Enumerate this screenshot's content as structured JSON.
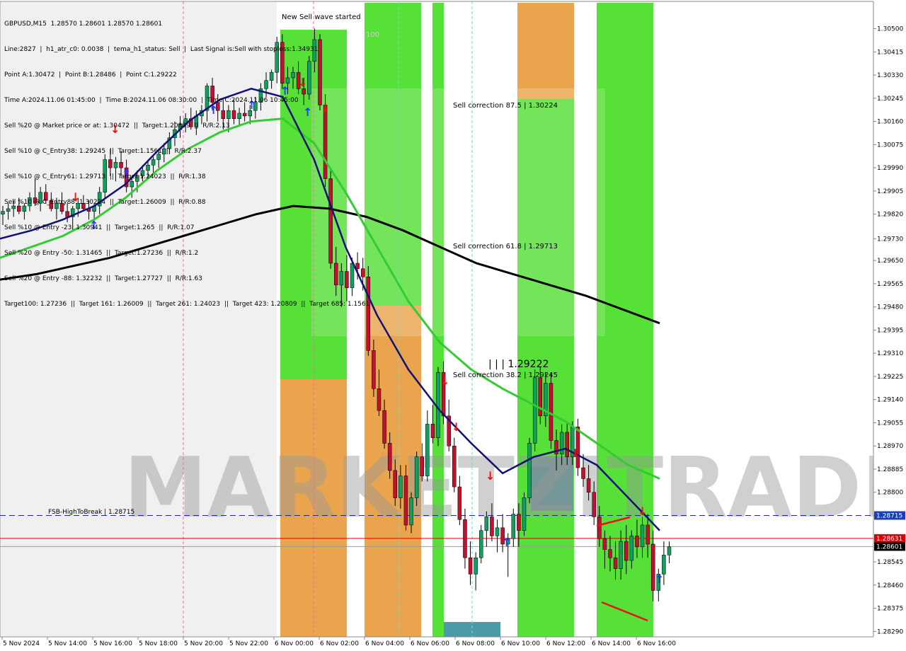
{
  "header": {
    "symbol_line": "GBPUSD,M15  1.28570 1.28601 1.28570 1.28601",
    "lines": [
      "Line:2827  |  h1_atr_c0: 0.0038  |  tema_h1_status: Sell  |  Last Signal is:Sell with stoploss:1.34931",
      "Point A:1.30472  |  Point B:1.28486  |  Point C:1.29222",
      "Time A:2024.11.06 01:45:00  |  Time B:2024.11.06 08:30:00  |  Time C:2024.11.06 10:45:00",
      "Sell %20 @ Market price or at: 1.30472  ||  Target:1.20809  ||  R/R:2.13",
      "Sell %10 @ C_Entry38: 1.29245  ||  Target:1.1561  ||  R/R:2.37",
      "Sell %10 @ C_Entry61: 1.29713  ||  Target:1.24023  ||  R/R:1.38",
      "Sell %10 @ C_Entry88: 1.30224  ||  Target:1.26009  ||  R/R:0.88",
      "Sell %10 @ Entry -23: 1.30941  ||  Target:1.265  ||  R/R:1.07",
      "Sell %20 @ Entry -50: 1.31465  ||  Target:1.27236  ||  R/R:1.2",
      "Sell %20 @ Entry -88: 1.32232  ||  Target:1.27727  ||  R/R:1.63",
      "Target100: 1.27236  ||  Target 161: 1.26009  ||  Target 261: 1.24023  ||  Target 423: 1.20809  ||  Target 685: 1.1561"
    ]
  },
  "annotations": {
    "new_wave": "New Sell wave started",
    "hundred": "100",
    "sell_corr_875": "Sell correction 87.5 | 1.30224",
    "sell_corr_618": "Sell correction 61.8 | 1.29713",
    "sell_corr_382": "Sell correction 38.2 | 1.29245",
    "point_c": "| | |  1.29222",
    "fsb": "FSB-HighToBreak  |  1.28715",
    "watermark": "MARKETZITRADE"
  },
  "price_tags": {
    "fsb": "1.28715",
    "current": "1.28601",
    "red_line": "1.28631"
  },
  "colors": {
    "bull": "#0ea060",
    "bear": "#c41030",
    "green_zone": "#44dd22",
    "orange_zone": "#e89a3a",
    "ma_fast": "#101078",
    "ma_mid": "#33cc33",
    "ma_slow": "#000000",
    "signal_up": "#1a3fff",
    "signal_down": "#ee1111"
  },
  "chart_data": {
    "type": "candlestick",
    "symbol": "GBPUSD",
    "timeframe": "M15",
    "ylim": [
      1.2827,
      1.306
    ],
    "y_ticks": [
      "1.30500",
      "1.30415",
      "1.30330",
      "1.30245",
      "1.30160",
      "1.30075",
      "1.29990",
      "1.29905",
      "1.29820",
      "1.29730",
      "1.29650",
      "1.29565",
      "1.29480",
      "1.29395",
      "1.29310",
      "1.29225",
      "1.29140",
      "1.29055",
      "1.28970",
      "1.28885",
      "1.28800",
      "1.28715",
      "1.28630",
      "1.28545",
      "1.28460",
      "1.28375",
      "1.28290"
    ],
    "x_ticks": [
      "5 Nov 2024",
      "5 Nov 14:00",
      "5 Nov 16:00",
      "5 Nov 18:00",
      "5 Nov 20:00",
      "5 Nov 22:00",
      "6 Nov 00:00",
      "6 Nov 02:00",
      "6 Nov 04:00",
      "6 Nov 06:00",
      "6 Nov 08:00",
      "6 Nov 10:00",
      "6 Nov 12:00",
      "6 Nov 14:00",
      "6 Nov 16:00"
    ],
    "candles": [
      [
        1.2982,
        1.2985,
        1.2978,
        1.2983
      ],
      [
        1.2983,
        1.2986,
        1.298,
        1.2984
      ],
      [
        1.2984,
        1.2987,
        1.2981,
        1.2985
      ],
      [
        1.2985,
        1.2988,
        1.2982,
        1.2983
      ],
      [
        1.2983,
        1.2986,
        1.298,
        1.2985
      ],
      [
        1.2985,
        1.299,
        1.2983,
        1.2988
      ],
      [
        1.2988,
        1.2995,
        1.2985,
        1.2986
      ],
      [
        1.2986,
        1.2992,
        1.2983,
        1.299
      ],
      [
        1.299,
        1.2993,
        1.2986,
        1.2987
      ],
      [
        1.2987,
        1.299,
        1.2983,
        1.2984
      ],
      [
        1.2984,
        1.2988,
        1.298,
        1.2986
      ],
      [
        1.2986,
        1.299,
        1.2982,
        1.2983
      ],
      [
        1.2983,
        1.2986,
        1.2979,
        1.2981
      ],
      [
        1.2981,
        1.2985,
        1.2976,
        1.2984
      ],
      [
        1.2984,
        1.2988,
        1.2981,
        1.2986
      ],
      [
        1.2986,
        1.2989,
        1.2983,
        1.2984
      ],
      [
        1.2984,
        1.2987,
        1.298,
        1.2983
      ],
      [
        1.2983,
        1.2986,
        1.2979,
        1.2985
      ],
      [
        1.2985,
        1.2992,
        1.2982,
        1.299
      ],
      [
        1.299,
        1.3004,
        1.2988,
        1.3002
      ],
      [
        1.3002,
        1.3006,
        1.2996,
        1.2999
      ],
      [
        1.2999,
        1.3003,
        1.2994,
        1.3001
      ],
      [
        1.3001,
        1.3005,
        1.2996,
        1.2999
      ],
      [
        1.2999,
        1.3002,
        1.299,
        1.2992
      ],
      [
        1.2992,
        1.2996,
        1.2988,
        1.2994
      ],
      [
        1.2994,
        1.2998,
        1.299,
        1.2996
      ],
      [
        1.2996,
        1.3,
        1.2994,
        1.2998
      ],
      [
        1.2998,
        1.3002,
        1.2995,
        1.3
      ],
      [
        1.3,
        1.3003,
        1.2997,
        1.3002
      ],
      [
        1.3002,
        1.3006,
        1.2999,
        1.3004
      ],
      [
        1.3004,
        1.3008,
        1.3001,
        1.3006
      ],
      [
        1.3006,
        1.3012,
        1.3004,
        1.301
      ],
      [
        1.301,
        1.3016,
        1.3007,
        1.3013
      ],
      [
        1.3013,
        1.3018,
        1.301,
        1.3015
      ],
      [
        1.3015,
        1.3019,
        1.3012,
        1.3017
      ],
      [
        1.3017,
        1.3021,
        1.3013,
        1.3014
      ],
      [
        1.3014,
        1.302,
        1.3011,
        1.3018
      ],
      [
        1.3018,
        1.3022,
        1.3015,
        1.302
      ],
      [
        1.302,
        1.303,
        1.3016,
        1.3029
      ],
      [
        1.3029,
        1.3032,
        1.302,
        1.3023
      ],
      [
        1.3023,
        1.3026,
        1.3016,
        1.302
      ],
      [
        1.302,
        1.3024,
        1.3013,
        1.3017
      ],
      [
        1.3017,
        1.3022,
        1.3012,
        1.302
      ],
      [
        1.302,
        1.3024,
        1.3015,
        1.3017
      ],
      [
        1.3017,
        1.3021,
        1.3014,
        1.3019
      ],
      [
        1.3019,
        1.3023,
        1.3016,
        1.3018
      ],
      [
        1.3018,
        1.3022,
        1.3015,
        1.302
      ],
      [
        1.302,
        1.3025,
        1.3017,
        1.3023
      ],
      [
        1.3023,
        1.303,
        1.302,
        1.3028
      ],
      [
        1.3028,
        1.3034,
        1.3025,
        1.3031
      ],
      [
        1.3031,
        1.3035,
        1.3028,
        1.3034
      ],
      [
        1.3034,
        1.3047,
        1.303,
        1.3045
      ],
      [
        1.3045,
        1.3048,
        1.3028,
        1.303
      ],
      [
        1.303,
        1.3036,
        1.3026,
        1.3032
      ],
      [
        1.3032,
        1.3036,
        1.3028,
        1.3034
      ],
      [
        1.3034,
        1.3038,
        1.3026,
        1.3028
      ],
      [
        1.3028,
        1.3032,
        1.3022,
        1.3026
      ],
      [
        1.3026,
        1.304,
        1.3024,
        1.3038
      ],
      [
        1.3038,
        1.305,
        1.3034,
        1.3046
      ],
      [
        1.3046,
        1.3048,
        1.302,
        1.3022
      ],
      [
        1.3022,
        1.3026,
        1.2992,
        1.2995
      ],
      [
        1.2995,
        1.2998,
        1.2962,
        1.2964
      ],
      [
        1.2964,
        1.297,
        1.2952,
        1.2956
      ],
      [
        1.2956,
        1.2964,
        1.2948,
        1.2961
      ],
      [
        1.2961,
        1.2967,
        1.295,
        1.2955
      ],
      [
        1.2955,
        1.2966,
        1.2952,
        1.2964
      ],
      [
        1.2964,
        1.2968,
        1.2958,
        1.2962
      ],
      [
        1.2962,
        1.2966,
        1.2954,
        1.2959
      ],
      [
        1.2959,
        1.2963,
        1.293,
        1.2932
      ],
      [
        1.2932,
        1.2936,
        1.2915,
        1.2918
      ],
      [
        1.2918,
        1.2925,
        1.2908,
        1.291
      ],
      [
        1.291,
        1.2914,
        1.2896,
        1.2898
      ],
      [
        1.2898,
        1.2902,
        1.2885,
        1.2888
      ],
      [
        1.2888,
        1.2892,
        1.2875,
        1.2878
      ],
      [
        1.2878,
        1.289,
        1.2874,
        1.2886
      ],
      [
        1.2886,
        1.289,
        1.2866,
        1.2868
      ],
      [
        1.2868,
        1.288,
        1.2865,
        1.2878
      ],
      [
        1.2878,
        1.2895,
        1.2875,
        1.2893
      ],
      [
        1.2893,
        1.2898,
        1.2884,
        1.2886
      ],
      [
        1.2886,
        1.291,
        1.2884,
        1.2905
      ],
      [
        1.2905,
        1.2912,
        1.2898,
        1.29
      ],
      [
        1.29,
        1.2926,
        1.2897,
        1.2924
      ],
      [
        1.2924,
        1.2928,
        1.2905,
        1.2908
      ],
      [
        1.2908,
        1.2914,
        1.2895,
        1.2897
      ],
      [
        1.2897,
        1.29,
        1.288,
        1.2882
      ],
      [
        1.2882,
        1.2886,
        1.2868,
        1.287
      ],
      [
        1.287,
        1.2874,
        1.2852,
        1.2856
      ],
      [
        1.2856,
        1.2862,
        1.2846,
        1.285
      ],
      [
        1.285,
        1.2858,
        1.2844,
        1.2856
      ],
      [
        1.2856,
        1.2868,
        1.2854,
        1.2866
      ],
      [
        1.2866,
        1.2873,
        1.286,
        1.2871
      ],
      [
        1.2871,
        1.2876,
        1.2862,
        1.2864
      ],
      [
        1.2864,
        1.287,
        1.2858,
        1.2867
      ],
      [
        1.2867,
        1.2872,
        1.2858,
        1.2861
      ],
      [
        1.2861,
        1.2865,
        1.2849,
        1.2863
      ],
      [
        1.2863,
        1.2874,
        1.286,
        1.2872
      ],
      [
        1.2872,
        1.2876,
        1.286,
        1.2866
      ],
      [
        1.2866,
        1.288,
        1.2864,
        1.2878
      ],
      [
        1.2878,
        1.29,
        1.2876,
        1.2898
      ],
      [
        1.2898,
        1.2925,
        1.2895,
        1.2922
      ],
      [
        1.2922,
        1.2926,
        1.2905,
        1.2908
      ],
      [
        1.2908,
        1.2924,
        1.2904,
        1.292
      ],
      [
        1.292,
        1.2924,
        1.2896,
        1.2899
      ],
      [
        1.2899,
        1.2903,
        1.2888,
        1.2894
      ],
      [
        1.2894,
        1.2905,
        1.289,
        1.2902
      ],
      [
        1.2902,
        1.2906,
        1.289,
        1.2893
      ],
      [
        1.2893,
        1.2906,
        1.289,
        1.2904
      ],
      [
        1.2904,
        1.2907,
        1.2886,
        1.2889
      ],
      [
        1.2889,
        1.2894,
        1.2882,
        1.2885
      ],
      [
        1.2885,
        1.289,
        1.2877,
        1.288
      ],
      [
        1.288,
        1.2884,
        1.2868,
        1.2871
      ],
      [
        1.2871,
        1.2875,
        1.286,
        1.2863
      ],
      [
        1.2863,
        1.2866,
        1.2852,
        1.2859
      ],
      [
        1.2859,
        1.2864,
        1.2851,
        1.2856
      ],
      [
        1.2856,
        1.2862,
        1.2848,
        1.2852
      ],
      [
        1.2852,
        1.2866,
        1.2848,
        1.2862
      ],
      [
        1.2862,
        1.2868,
        1.285,
        1.2855
      ],
      [
        1.2855,
        1.2866,
        1.2852,
        1.2864
      ],
      [
        1.2864,
        1.287,
        1.2856,
        1.286
      ],
      [
        1.286,
        1.2871,
        1.2856,
        1.2868
      ],
      [
        1.2868,
        1.2872,
        1.2856,
        1.2861
      ],
      [
        1.2861,
        1.2866,
        1.284,
        1.2844
      ],
      [
        1.2844,
        1.2852,
        1.284,
        1.285
      ],
      [
        1.285,
        1.2862,
        1.2846,
        1.2857
      ],
      [
        1.2857,
        1.2862,
        1.2854,
        1.286
      ]
    ],
    "ma_fast": [
      1.2973,
      1.2976,
      1.298,
      1.2985,
      1.2993,
      1.3005,
      1.3016,
      1.3024,
      1.3028,
      1.3025,
      1.3002,
      1.297,
      1.2945,
      1.2925,
      1.291,
      1.2898,
      1.2887,
      1.2893,
      1.2896,
      1.289,
      1.2878,
      1.2866
    ],
    "ma_mid": [
      1.2966,
      1.297,
      1.2974,
      1.298,
      1.2988,
      1.2998,
      1.3006,
      1.3012,
      1.3016,
      1.3017,
      1.3008,
      1.299,
      1.297,
      1.295,
      1.2935,
      1.2925,
      1.2918,
      1.2912,
      1.2906,
      1.2898,
      1.289,
      1.2885
    ],
    "ma_slow": [
      1.2958,
      1.296,
      1.2963,
      1.2966,
      1.297,
      1.2974,
      1.2978,
      1.2982,
      1.2985,
      1.2984,
      1.2981,
      1.2976,
      1.297,
      1.2964,
      1.296,
      1.2956,
      1.2952,
      1.2947,
      1.2942
    ]
  }
}
